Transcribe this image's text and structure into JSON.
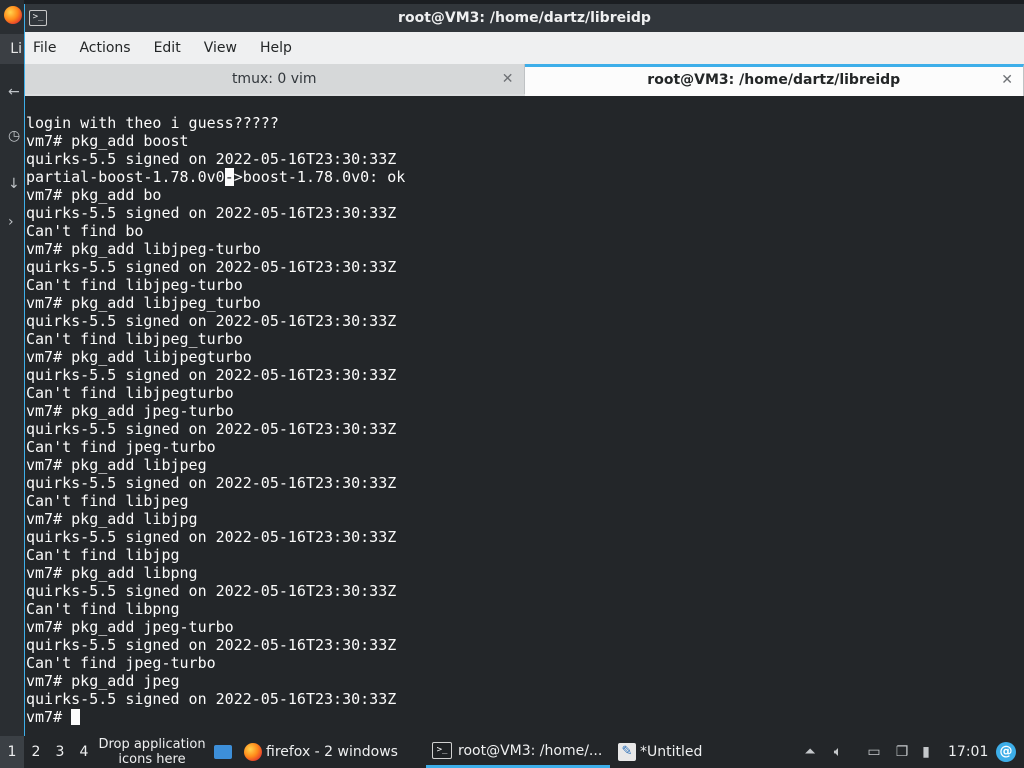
{
  "window": {
    "title": "root@VM3: /home/dartz/libreidp",
    "menu": [
      "File",
      "Actions",
      "Edit",
      "View",
      "Help"
    ],
    "tabs": [
      {
        "label": "tmux: 0 vim",
        "active": false
      },
      {
        "label": "root@VM3: /home/dartz/libreidp",
        "active": true
      }
    ]
  },
  "background": {
    "tab_fragment": "Li"
  },
  "terminal": {
    "lines": [
      "login with theo i guess?????",
      "vm7# pkg_add boost",
      "quirks-5.5 signed on 2022-05-16T23:30:33Z",
      "partial-boost-1.78.0v0->boost-1.78.0v0: ok",
      "vm7# pkg_add bo",
      "quirks-5.5 signed on 2022-05-16T23:30:33Z",
      "Can't find bo",
      "vm7# pkg_add libjpeg-turbo",
      "quirks-5.5 signed on 2022-05-16T23:30:33Z",
      "Can't find libjpeg-turbo",
      "vm7# pkg_add libjpeg_turbo",
      "quirks-5.5 signed on 2022-05-16T23:30:33Z",
      "Can't find libjpeg_turbo",
      "vm7# pkg_add libjpegturbo",
      "quirks-5.5 signed on 2022-05-16T23:30:33Z",
      "Can't find libjpegturbo",
      "vm7# pkg_add jpeg-turbo",
      "quirks-5.5 signed on 2022-05-16T23:30:33Z",
      "Can't find jpeg-turbo",
      "vm7# pkg_add libjpeg",
      "quirks-5.5 signed on 2022-05-16T23:30:33Z",
      "Can't find libjpeg",
      "vm7# pkg_add libjpg",
      "quirks-5.5 signed on 2022-05-16T23:30:33Z",
      "Can't find libjpg",
      "vm7# pkg_add libpng",
      "quirks-5.5 signed on 2022-05-16T23:30:33Z",
      "Can't find libpng",
      "vm7# pkg_add jpeg-turbo",
      "quirks-5.5 signed on 2022-05-16T23:30:33Z",
      "Can't find jpeg-turbo",
      "vm7# pkg_add jpeg",
      "quirks-5.5 signed on 2022-05-16T23:30:33Z"
    ],
    "prompt": "vm7# "
  },
  "taskbar": {
    "workspaces": [
      "1",
      "2",
      "3",
      "4"
    ],
    "active_workspace": "1",
    "drop_hint": "Drop application icons here",
    "tasks": [
      {
        "label": "firefox - 2 windows",
        "icon": "firefox-icon"
      },
      {
        "label": "root@VM3: /home/...",
        "icon": "terminal-icon",
        "active": true
      },
      {
        "label": "*Untitled",
        "icon": "text-editor-icon"
      }
    ],
    "clock": "17:01"
  },
  "colors": {
    "accent": "#3daee9",
    "terminal_bg": "#232629",
    "terminal_fg": "#fcfcfc"
  }
}
